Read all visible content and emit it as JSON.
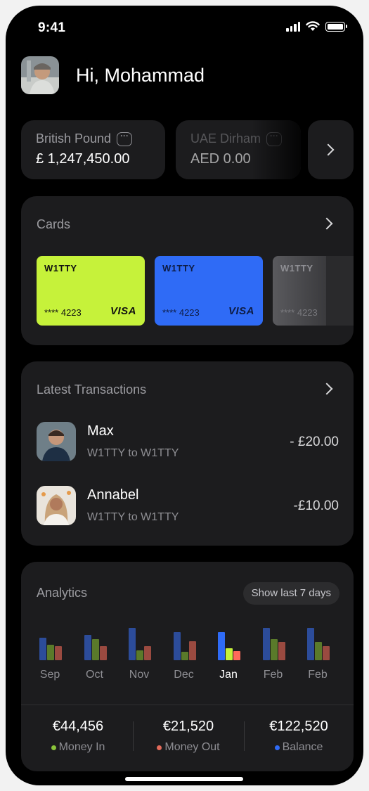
{
  "status_bar": {
    "time": "9:41",
    "icons": [
      "signal-icon",
      "wifi-icon",
      "battery-icon"
    ]
  },
  "header": {
    "greeting": "Hi, Mohammad"
  },
  "accounts": [
    {
      "currency": "British Pound",
      "balance": "£ 1,247,450.00"
    },
    {
      "currency": "UAE Dirham",
      "balance": "AED 0.00"
    }
  ],
  "cards_section": {
    "title": "Cards",
    "cards": [
      {
        "brand": "W1TTY",
        "number": "**** 4223",
        "network": "VISA",
        "color": "#c6f23a",
        "text_color": "#111111"
      },
      {
        "brand": "W1TTY",
        "number": "**** 4223",
        "network": "VISA",
        "color": "#2f6bf6",
        "text_color": "#0e1c44"
      },
      {
        "brand": "W1TTY",
        "number": "**** 4223",
        "network": "VISA",
        "color": "#4a4a4e",
        "text_color": "#8e8e93"
      }
    ]
  },
  "transactions_section": {
    "title": "Latest Transactions",
    "items": [
      {
        "name": "Max",
        "description": "W1TTY to W1TTY",
        "amount": "- £20.00"
      },
      {
        "name": "Annabel",
        "description": "W1TTY to W1TTY",
        "amount": "-£10.00"
      }
    ]
  },
  "analytics": {
    "title": "Analytics",
    "period_button": "Show last 7 days",
    "colors": {
      "money_in": "#8ac43a",
      "money_out": "#e26a5a",
      "balance": "#2f6bf6"
    },
    "chart_data": {
      "type": "bar",
      "categories": [
        "Sep",
        "Oct",
        "Nov",
        "Dec",
        "Jan",
        "Feb",
        "Feb"
      ],
      "active_category_index": 4,
      "series": [
        {
          "name": "Balance",
          "values": [
            32,
            36,
            46,
            40,
            40,
            46,
            46
          ]
        },
        {
          "name": "Money In",
          "values": [
            22,
            30,
            14,
            12,
            17,
            30,
            26
          ]
        },
        {
          "name": "Money Out",
          "values": [
            20,
            20,
            20,
            27,
            13,
            26,
            20
          ]
        }
      ],
      "ylim": [
        0,
        50
      ]
    },
    "stats": [
      {
        "value": "€44,456",
        "label": "Money In",
        "color": "#8ac43a"
      },
      {
        "value": "€21,520",
        "label": "Money Out",
        "color": "#e26a5a"
      },
      {
        "value": "€122,520",
        "label": "Balance",
        "color": "#2f6bf6"
      }
    ]
  }
}
